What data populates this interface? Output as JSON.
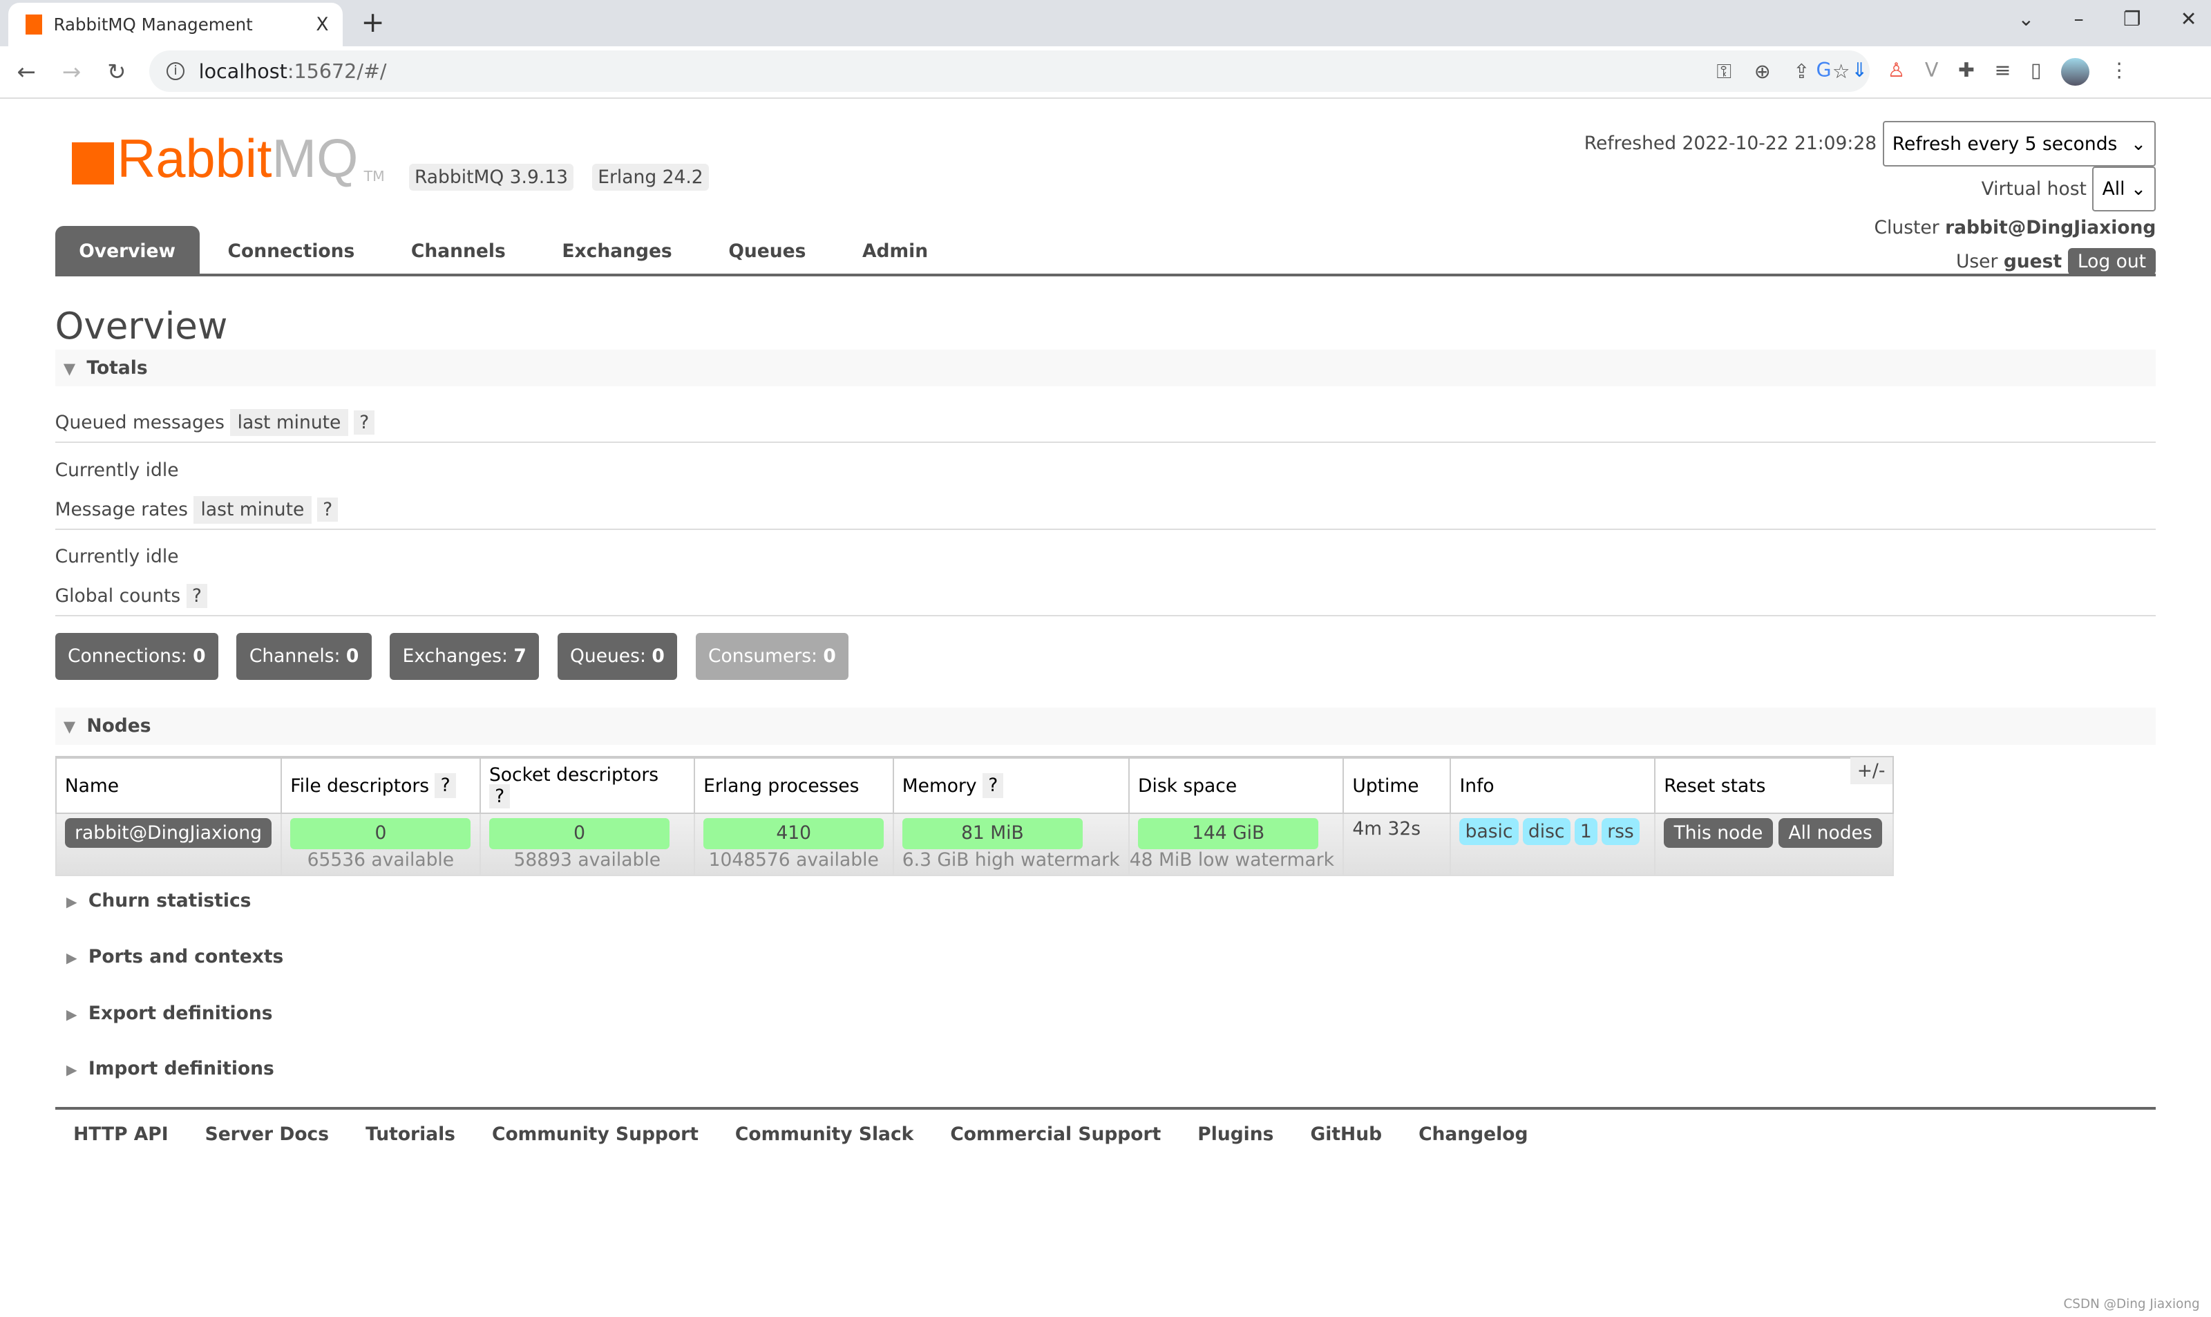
{
  "browser": {
    "tab_title": "RabbitMQ Management",
    "tab_close": "X",
    "new_tab": "+",
    "url_host": "localhost",
    "url_rest": ":15672/#/",
    "window_controls": [
      "⌄",
      "–",
      "❐",
      "✕"
    ]
  },
  "header": {
    "logo_rabbit": "Rabbit",
    "logo_mq": "MQ",
    "logo_tm": "TM",
    "version": "RabbitMQ 3.9.13",
    "erlang": "Erlang 24.2",
    "refreshed": "Refreshed 2022-10-22 21:09:28",
    "refresh_select": "Refresh every 5 seconds",
    "vhost_label": "Virtual host",
    "vhost_value": "All",
    "cluster_label": "Cluster",
    "cluster_value": "rabbit@DingJiaxiong",
    "user_label": "User",
    "user_value": "guest",
    "logout": "Log out"
  },
  "nav": [
    "Overview",
    "Connections",
    "Channels",
    "Exchanges",
    "Queues",
    "Admin"
  ],
  "page_title": "Overview",
  "totals": {
    "title": "Totals",
    "queued_label": "Queued messages",
    "queued_range": "last minute",
    "help": "?",
    "idle1": "Currently idle",
    "rates_label": "Message rates",
    "rates_range": "last minute",
    "idle2": "Currently idle",
    "global_label": "Global counts",
    "counts": [
      {
        "label": "Connections:",
        "value": "0"
      },
      {
        "label": "Channels:",
        "value": "0"
      },
      {
        "label": "Exchanges:",
        "value": "7"
      },
      {
        "label": "Queues:",
        "value": "0"
      },
      {
        "label": "Consumers:",
        "value": "0"
      }
    ]
  },
  "nodes": {
    "title": "Nodes",
    "headers": [
      "Name",
      "File descriptors",
      "Socket descriptors",
      "Erlang processes",
      "Memory",
      "Disk space",
      "Uptime",
      "Info",
      "Reset stats"
    ],
    "plus_minus": "+/-",
    "row": {
      "name": "rabbit@DingJiaxiong",
      "fd": "0",
      "fd_sub": "65536 available",
      "sd": "0",
      "sd_sub": "58893 available",
      "ep": "410",
      "ep_sub": "1048576 available",
      "mem": "81 MiB",
      "mem_sub": "6.3 GiB high watermark",
      "disk": "144 GiB",
      "disk_sub": "48 MiB low watermark",
      "uptime": "4m 32s",
      "info": [
        "basic",
        "disc",
        "1",
        "rss"
      ],
      "reset_this": "This node",
      "reset_all": "All nodes"
    }
  },
  "sections": [
    "Churn statistics",
    "Ports and contexts",
    "Export definitions",
    "Import definitions"
  ],
  "footer": [
    "HTTP API",
    "Server Docs",
    "Tutorials",
    "Community Support",
    "Community Slack",
    "Commercial Support",
    "Plugins",
    "GitHub",
    "Changelog"
  ],
  "watermark": "CSDN @Ding Jiaxiong",
  "colors": {
    "brand": "#ff6600",
    "ok": "#99f999",
    "info": "#99ebff",
    "tab_active": "#666666"
  }
}
